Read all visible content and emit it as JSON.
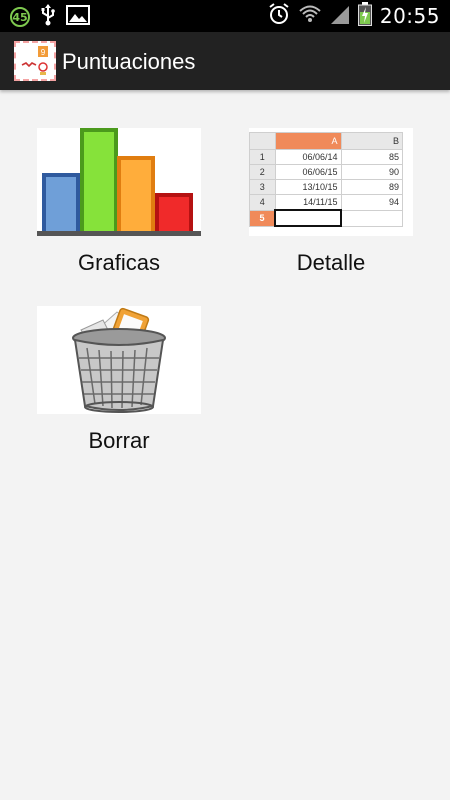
{
  "status_bar": {
    "notification_badge": "45",
    "time": "20:55"
  },
  "action_bar": {
    "title": "Puntuaciones",
    "app_icon_text": "9"
  },
  "tiles": [
    {
      "label": "Graficas",
      "icon": "bar-chart-icon"
    },
    {
      "label": "Detalle",
      "icon": "spreadsheet-icon"
    },
    {
      "label": "Borrar",
      "icon": "trash-can-icon"
    }
  ],
  "sheet": {
    "col_headers": [
      "A",
      "B"
    ],
    "rows": [
      {
        "n": "1",
        "a": "06/06/14",
        "b": "85"
      },
      {
        "n": "2",
        "a": "06/06/15",
        "b": "90"
      },
      {
        "n": "3",
        "a": "13/10/15",
        "b": "89"
      },
      {
        "n": "4",
        "a": "14/11/15",
        "b": "94"
      },
      {
        "n": "5",
        "a": "",
        "b": ""
      }
    ]
  },
  "colors": {
    "accent_green": "#7ec94f",
    "action_bar": "#222222",
    "background": "#f3f3f3"
  }
}
